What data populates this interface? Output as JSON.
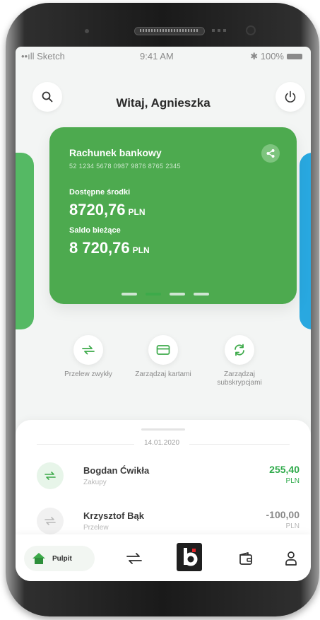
{
  "status_bar": {
    "signal": "••ıll Sketch",
    "time": "9:41 AM",
    "battery": "✱ 100%"
  },
  "header": {
    "greeting": "Witaj, Agnieszka",
    "search_icon": "search-icon",
    "power_icon": "power-icon"
  },
  "account_card": {
    "title": "Rachunek bankowy",
    "number": "52 1234 5678 0987 9876 8765 2345",
    "available_label": "Dostępne środki",
    "available_value": "8720,76",
    "available_currency": "PLN",
    "balance_label": "Saldo bieżące",
    "balance_value": "8 720,76",
    "balance_currency": "PLN",
    "color": "#4daa4f"
  },
  "carousel": {
    "count": 4,
    "active_index": 1
  },
  "quick_actions": [
    {
      "label": "Przelew zwykły",
      "icon": "transfer-icon"
    },
    {
      "label": "Zarządzaj kartami",
      "icon": "card-icon"
    },
    {
      "label": "Zarządzaj subskrypcjami",
      "icon": "refresh-icon"
    }
  ],
  "transactions": {
    "date": "14.01.2020",
    "items": [
      {
        "name": "Bogdan Ćwikła",
        "category": "Zakupy",
        "amount": "255,40",
        "currency": "PLN",
        "color": "#2eaa4a"
      },
      {
        "name": "Krzysztof Bąk",
        "category": "Przelew",
        "amount": "-100,00",
        "currency": "PLN",
        "color": "#8a8a8a"
      }
    ]
  },
  "nav": {
    "home_label": "Pulpit"
  },
  "colors": {
    "accent": "#3daa4a",
    "brand_dark": "#1f1f1f",
    "secondary_card": "#29a8e0"
  }
}
